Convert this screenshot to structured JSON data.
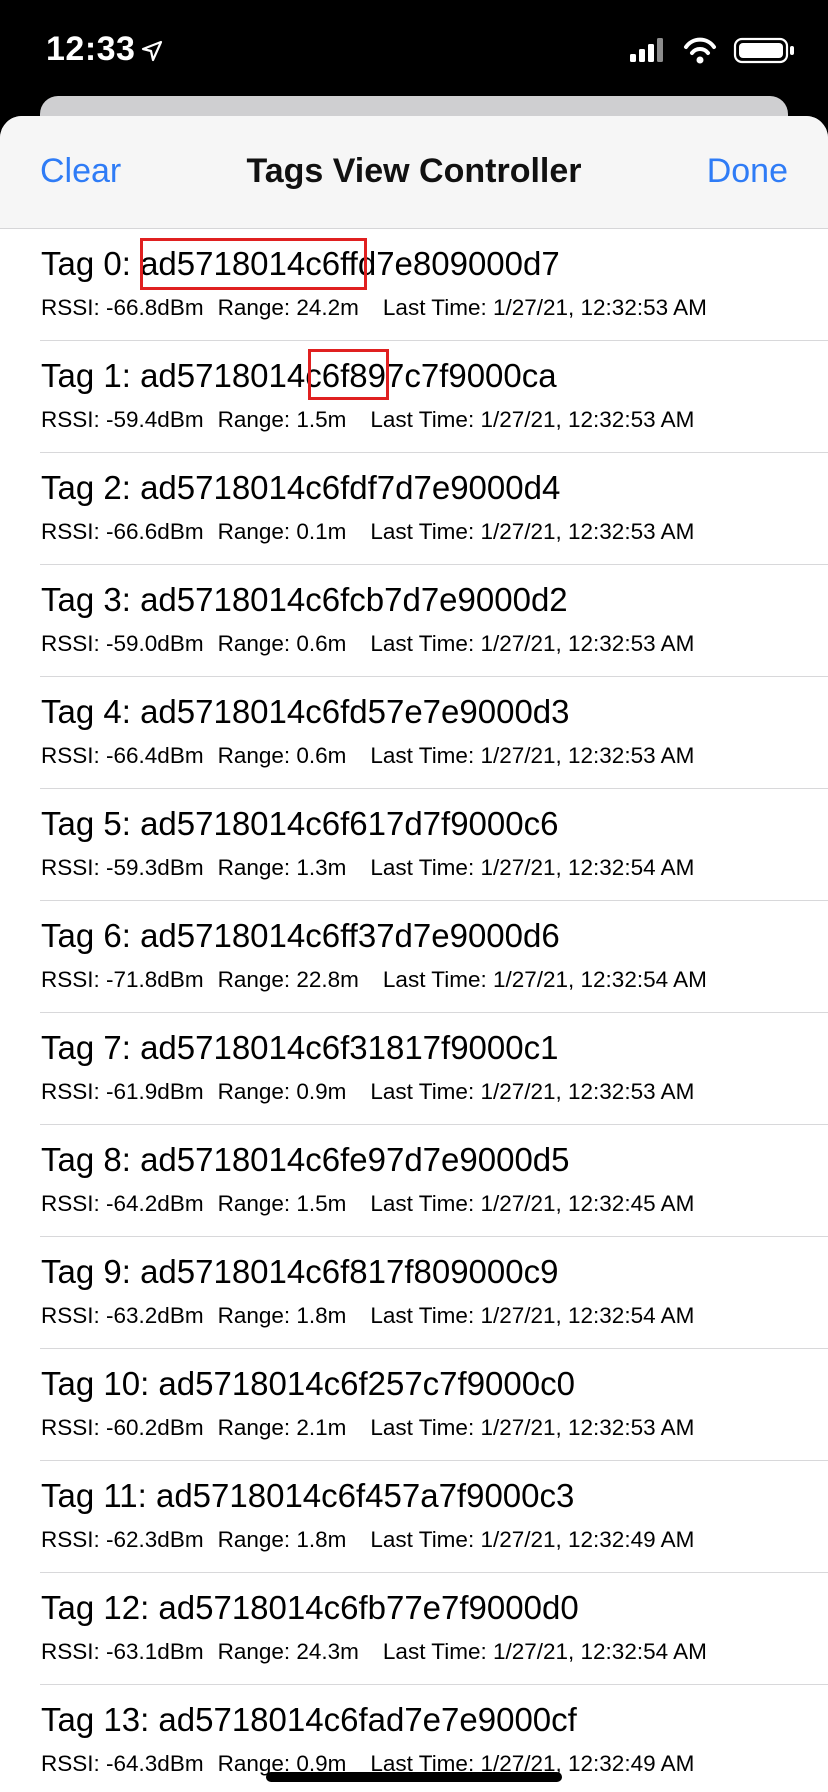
{
  "status": {
    "time": "12:33",
    "location_icon": "location-arrow-icon",
    "icons": [
      "signal-bars-icon",
      "wifi-icon",
      "battery-icon"
    ]
  },
  "nav": {
    "left": "Clear",
    "title": "Tags View Controller",
    "right": "Done"
  },
  "colors": {
    "accent": "#2f7cf6",
    "highlight": "#e02020",
    "navbar_bg": "#f6f6f6"
  },
  "tags": [
    {
      "title": "Tag 0: ad5718014c6ffd7e809000d7",
      "rssi": "RSSI: -66.8dBm",
      "range": "Range: 24.2m",
      "last": "Last Time: 1/27/21, 12:32:53 AM"
    },
    {
      "title": "Tag 1: ad5718014c6f897c7f9000ca",
      "rssi": "RSSI: -59.4dBm",
      "range": "Range: 1.5m",
      "last": "Last Time: 1/27/21, 12:32:53 AM"
    },
    {
      "title": "Tag 2: ad5718014c6fdf7d7e9000d4",
      "rssi": "RSSI: -66.6dBm",
      "range": "Range: 0.1m",
      "last": "Last Time: 1/27/21, 12:32:53 AM"
    },
    {
      "title": "Tag 3: ad5718014c6fcb7d7e9000d2",
      "rssi": "RSSI: -59.0dBm",
      "range": "Range: 0.6m",
      "last": "Last Time: 1/27/21, 12:32:53 AM"
    },
    {
      "title": "Tag 4: ad5718014c6fd57e7e9000d3",
      "rssi": "RSSI: -66.4dBm",
      "range": "Range: 0.6m",
      "last": "Last Time: 1/27/21, 12:32:53 AM"
    },
    {
      "title": "Tag 5: ad5718014c6f617d7f9000c6",
      "rssi": "RSSI: -59.3dBm",
      "range": "Range: 1.3m",
      "last": "Last Time: 1/27/21, 12:32:54 AM"
    },
    {
      "title": "Tag 6: ad5718014c6ff37d7e9000d6",
      "rssi": "RSSI: -71.8dBm",
      "range": "Range: 22.8m",
      "last": "Last Time: 1/27/21, 12:32:54 AM"
    },
    {
      "title": "Tag 7: ad5718014c6f31817f9000c1",
      "rssi": "RSSI: -61.9dBm",
      "range": "Range: 0.9m",
      "last": "Last Time: 1/27/21, 12:32:53 AM"
    },
    {
      "title": "Tag 8: ad5718014c6fe97d7e9000d5",
      "rssi": "RSSI: -64.2dBm",
      "range": "Range: 1.5m",
      "last": "Last Time: 1/27/21, 12:32:45 AM"
    },
    {
      "title": "Tag 9: ad5718014c6f817f809000c9",
      "rssi": "RSSI: -63.2dBm",
      "range": "Range: 1.8m",
      "last": "Last Time: 1/27/21, 12:32:54 AM"
    },
    {
      "title": "Tag 10: ad5718014c6f257c7f9000c0",
      "rssi": "RSSI: -60.2dBm",
      "range": "Range: 2.1m",
      "last": "Last Time: 1/27/21, 12:32:53 AM"
    },
    {
      "title": "Tag 11: ad5718014c6f457a7f9000c3",
      "rssi": "RSSI: -62.3dBm",
      "range": "Range: 1.8m",
      "last": "Last Time: 1/27/21, 12:32:49 AM"
    },
    {
      "title": "Tag 12: ad5718014c6fb77e7f9000d0",
      "rssi": "RSSI: -63.1dBm",
      "range": "Range: 24.3m",
      "last": "Last Time: 1/27/21, 12:32:54 AM"
    },
    {
      "title": "Tag 13: ad5718014c6fad7e7e9000cf",
      "rssi": "RSSI: -64.3dBm",
      "range": "Range: 0.9m",
      "last": "Last Time: 1/27/21, 12:32:49 AM"
    }
  ]
}
